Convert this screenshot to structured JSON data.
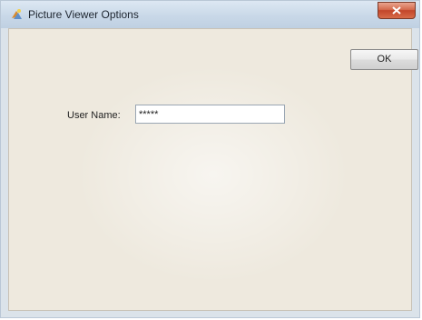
{
  "window": {
    "title": "Picture Viewer Options",
    "icon": "picture-viewer-icon",
    "close_icon": "close-icon"
  },
  "dialog": {
    "ok_label": "OK",
    "username_label": "User Name:",
    "username_value": "*****"
  },
  "colors": {
    "titlebar": "#c9d8e8",
    "client_background": "#eee9de",
    "close_button": "#c2452a"
  }
}
